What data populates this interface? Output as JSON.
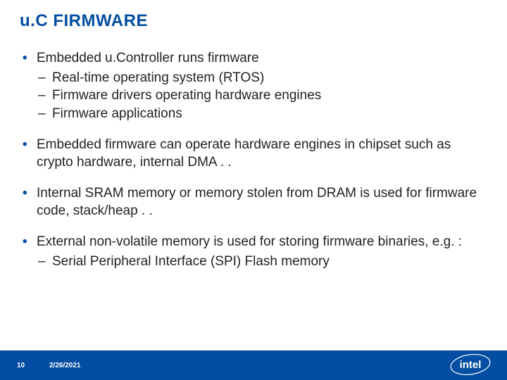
{
  "title": "u.C FIRMWARE",
  "bullets": [
    {
      "text": "Embedded u.Controller runs firmware",
      "sub": [
        "Real-time operating system (RTOS)",
        "Firmware drivers operating hardware engines",
        "Firmware applications"
      ]
    },
    {
      "text": "Embedded firmware can operate hardware engines in chipset such as crypto hardware, internal DMA . .",
      "sub": []
    },
    {
      "text": "Internal SRAM memory or memory stolen from DRAM is used for firmware code, stack/heap . .",
      "sub": []
    },
    {
      "text": "External non-volatile memory is used for storing firmware binaries, e.g. :",
      "sub": [
        "Serial Peripheral Interface (SPI) Flash memory"
      ]
    }
  ],
  "footer": {
    "page": "10",
    "date": "2/26/2021",
    "logo_name": "intel"
  }
}
